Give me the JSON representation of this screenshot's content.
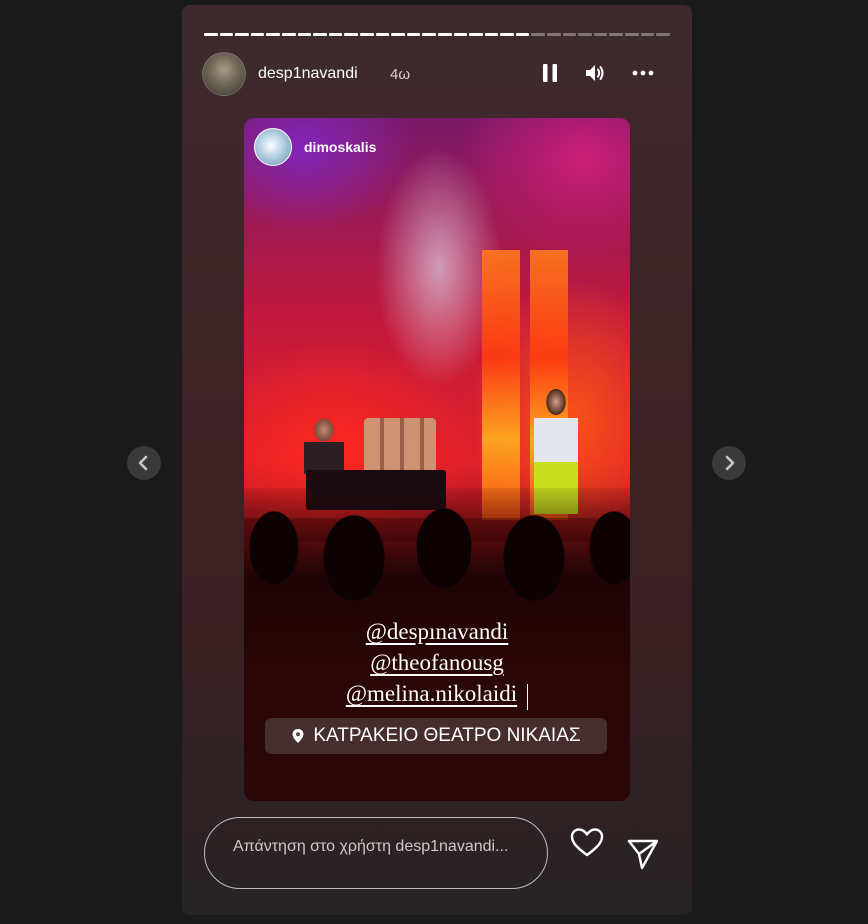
{
  "story": {
    "username": "desp1navandi",
    "age": "4ω",
    "progress": {
      "total_segments": 30,
      "completed_segments": 21
    },
    "controls": {
      "pause_icon": "pause-icon",
      "volume_icon": "volume-icon",
      "more_icon": "more-options-icon"
    },
    "repost": {
      "username": "dimoskalis"
    },
    "mentions": [
      "@despınavandi",
      "@theofanousg",
      "@melina.nikolaidi"
    ],
    "location": {
      "icon": "location-pin-icon",
      "label": "ΚΑΤΡΑΚΕΙΟ ΘΕΑΤΡΟ ΝΙΚΑΙΑΣ"
    },
    "reply": {
      "placeholder": "Απάντηση στο χρήστη desp1navandi..."
    },
    "actions": {
      "like_icon": "heart-icon",
      "share_icon": "send-icon"
    }
  },
  "navigation": {
    "prev_icon": "chevron-left-icon",
    "next_icon": "chevron-right-icon"
  },
  "colors": {
    "page_background": "#1a1a1a",
    "story_background": "#3d2326",
    "text": "#ffffff"
  }
}
